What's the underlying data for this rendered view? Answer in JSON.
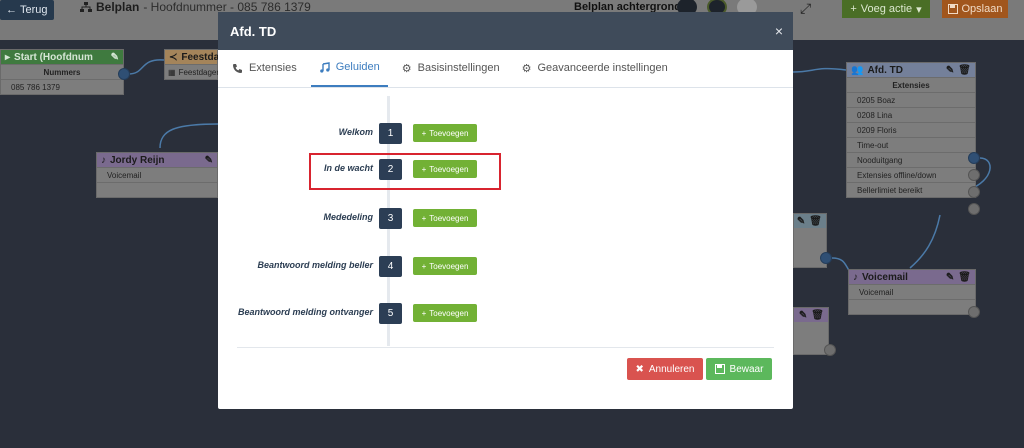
{
  "topbar": {
    "back_label": "Terug",
    "app_title": "Belplan",
    "app_subtitle": "- Hoofdnummer - 085 786 1379",
    "background_label": "Belplan achtergrond",
    "add_action_label": "Voeg actie",
    "save_label": "Opslaan",
    "swatch_colors": [
      "#1d232b",
      "#1d232b",
      "#9a9a9a"
    ]
  },
  "nodes": {
    "start": {
      "title": "Start (Hoofdnum",
      "header_row": "Nummers",
      "rows": [
        "085 786 1379"
      ]
    },
    "holidays": {
      "title": "Feestdag",
      "rows": [
        "Feestdagen"
      ]
    },
    "jordy": {
      "title": "Jordy Reijn",
      "rows": [
        "Voicemail",
        ""
      ]
    },
    "afd_td": {
      "title": "Afd. TD",
      "header_row": "Extensies",
      "rows": [
        "0205 Boaz",
        "0208 Lina",
        "0209 Floris",
        "Time-out",
        "Nooduitgang",
        "Extensies offline/down",
        "Bellerlimiet bereikt"
      ]
    },
    "voicemail": {
      "title": "Voicemail",
      "rows": [
        "Voicemail",
        ""
      ]
    }
  },
  "modal": {
    "title": "Afd. TD",
    "close_symbol": "×",
    "tabs": [
      {
        "label": "Extensies",
        "icon": "phone-icon",
        "active": false
      },
      {
        "label": "Geluiden",
        "icon": "music-icon",
        "active": true
      },
      {
        "label": "Basisinstellingen",
        "icon": "gear-icon",
        "active": false
      },
      {
        "label": "Geavanceerde instellingen",
        "icon": "gear-icon",
        "active": false
      }
    ],
    "sounds": [
      {
        "label": "Welkom",
        "number": "1",
        "add_label": "Toevoegen"
      },
      {
        "label": "In de wacht",
        "number": "2",
        "add_label": "Toevoegen"
      },
      {
        "label": "Mededeling",
        "number": "3",
        "add_label": "Toevoegen"
      },
      {
        "label": "Beantwoord melding beller",
        "number": "4",
        "add_label": "Toevoegen"
      },
      {
        "label": "Beantwoord melding ontvanger",
        "number": "5",
        "add_label": "Toevoegen"
      }
    ],
    "highlighted_sound": "In de wacht",
    "cancel_label": "Annuleren",
    "save_label": "Bewaar"
  },
  "colors": {
    "modal_header": "#3f4b5a",
    "accent_blue": "#3d7dbf",
    "add_green": "#72b135",
    "cancel_red": "#d9534f",
    "save_green": "#5cb85c",
    "highlight_red": "#d8242f"
  }
}
